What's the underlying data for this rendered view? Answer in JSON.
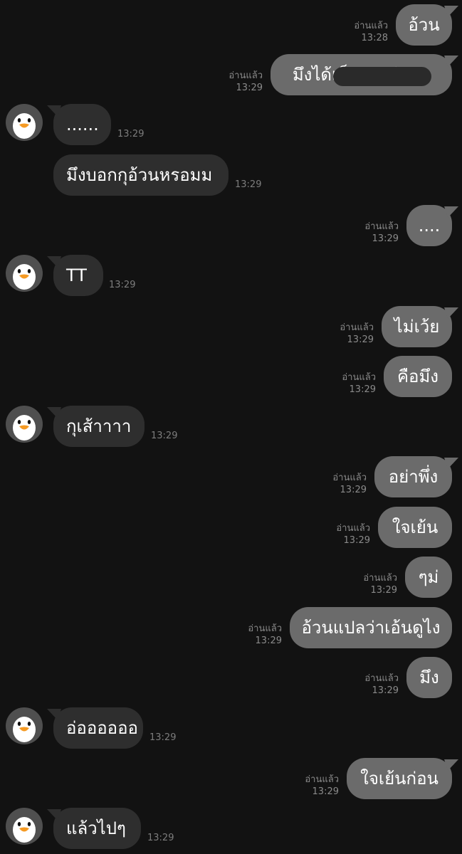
{
  "messages": [
    {
      "side": "me",
      "text": "อ้วน",
      "read": "อ่านแล้ว",
      "time": "13:28"
    },
    {
      "side": "me",
      "text": "มึงได้เห็นรูปกูยังนะ",
      "read": "อ่านแล้ว",
      "time": "13:29",
      "redacted": true
    },
    {
      "side": "them",
      "text": "......",
      "time": "13:29"
    },
    {
      "side": "them",
      "text": "มึงบอกกุอ้วนหรอมม",
      "time": "13:29"
    },
    {
      "side": "me",
      "text": "....",
      "read": "อ่านแล้ว",
      "time": "13:29"
    },
    {
      "side": "them",
      "text": "TT",
      "time": "13:29"
    },
    {
      "side": "me",
      "text": "ไม่เว้ย",
      "read": "อ่านแล้ว",
      "time": "13:29"
    },
    {
      "side": "me",
      "text": "คือมึง",
      "read": "อ่านแล้ว",
      "time": "13:29"
    },
    {
      "side": "them",
      "text": "กุเส้าาาา",
      "time": "13:29"
    },
    {
      "side": "me",
      "text": "อย่าพึ่ง",
      "read": "อ่านแล้ว",
      "time": "13:29"
    },
    {
      "side": "me",
      "text": "ใจเย้น",
      "read": "อ่านแล้ว",
      "time": "13:29"
    },
    {
      "side": "me",
      "text": "ๆม่",
      "read": "อ่านแล้ว",
      "time": "13:29"
    },
    {
      "side": "me",
      "text": "อ้วนแปลว่าเอ้นดูไง",
      "read": "อ่านแล้ว",
      "time": "13:29"
    },
    {
      "side": "me",
      "text": "มึง",
      "read": "อ่านแล้ว",
      "time": "13:29"
    },
    {
      "side": "them",
      "text": "อ่ออออออ",
      "time": "13:29"
    },
    {
      "side": "me",
      "text": "ใจเย้นก่อน",
      "read": "อ่านแล้ว",
      "time": "13:29"
    },
    {
      "side": "them",
      "text": "แล้วไปๆ",
      "time": "13:29"
    }
  ],
  "avatar_icon": "penguin-icon",
  "colors": {
    "background": "#121212",
    "outgoing_bubble": "#6b6b6b",
    "incoming_bubble": "#2e2e2e",
    "meta_text": "#8a8a8a"
  }
}
